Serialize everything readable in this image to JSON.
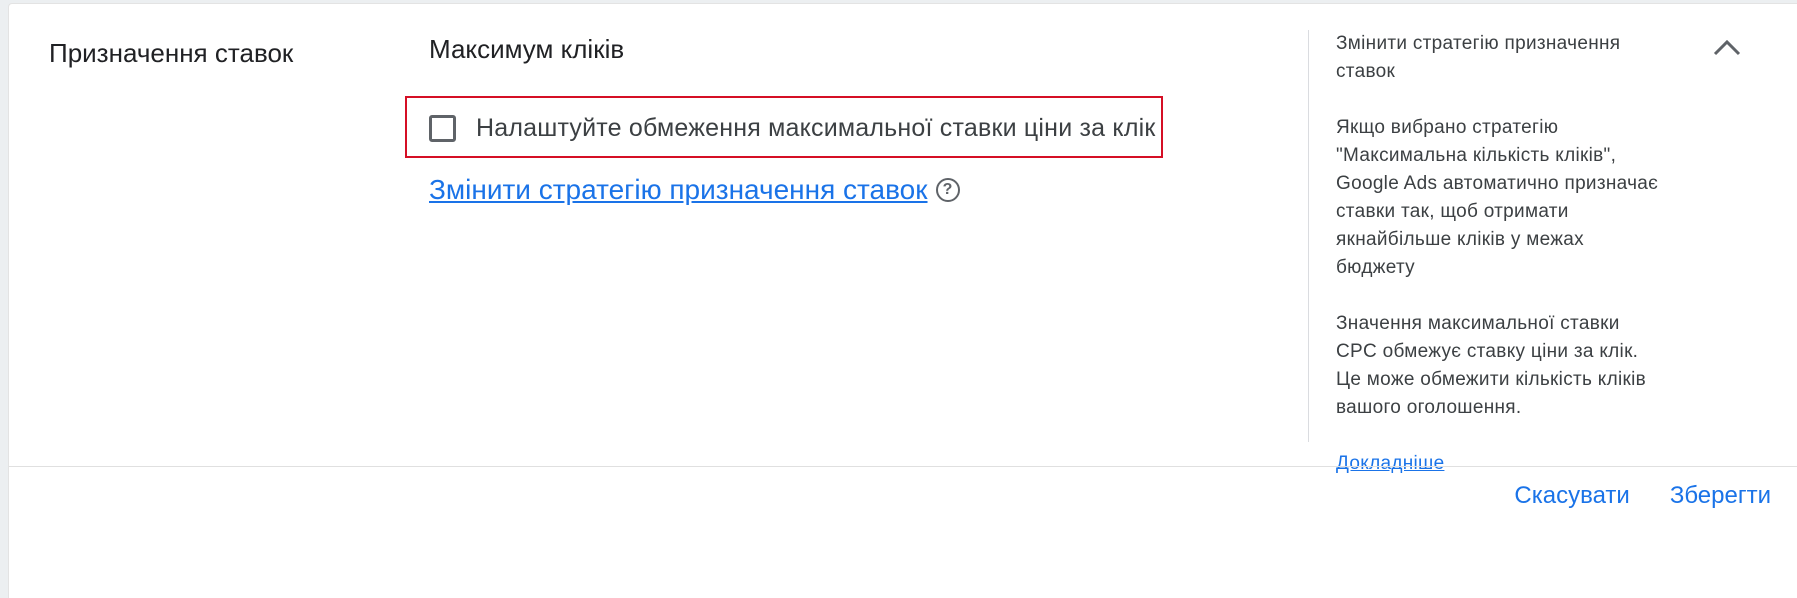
{
  "section": {
    "title": "Призначення ставок"
  },
  "main": {
    "strategy_title": "Максимум кліків",
    "checkbox_label": "Налаштуйте обмеження максимальної ставки ціни за клік",
    "checkbox_checked": false,
    "change_link": "Змінити стратегію призначення ставок",
    "help_icon_glyph": "?",
    "highlight_color": "#d50f25"
  },
  "side_panel": {
    "title": "Змінити стратегію призначення ставок",
    "paragraph1": "Якщо вибрано стратегію \"Максимальна кількість кліків\", Google Ads автоматично призначає ставки так, щоб отримати якнайбільше кліків у межах бюджету",
    "paragraph2": "Значення максимальної ставки CPC обмежує ставку ціни за клік. Це може обмежити кількість кліків вашого оголошення.",
    "learn_more": "Докладніше"
  },
  "footer": {
    "cancel": "Скасувати",
    "save": "Зберегти"
  },
  "colors": {
    "link": "#1a73e8",
    "text": "#202124"
  }
}
